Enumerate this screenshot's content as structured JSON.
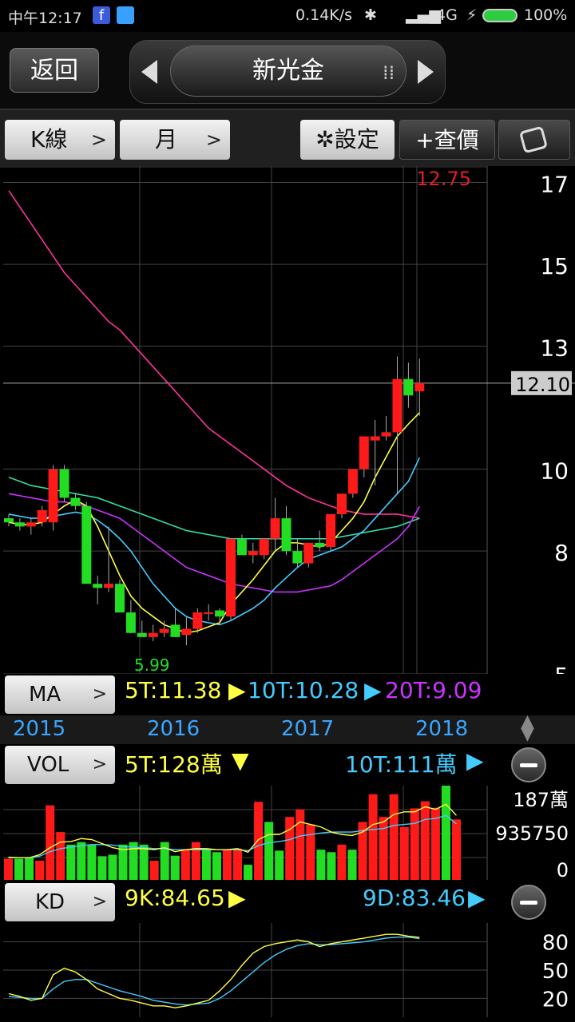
{
  "status_bar": {
    "time": "中午12:17",
    "speed": "0.14K/s",
    "network": "4G",
    "battery": "100%"
  },
  "header": {
    "back_label": "返回",
    "stock_name": "新光金"
  },
  "toolbar": {
    "chart_type": "K線",
    "period": "月",
    "settings_label": "✲設定",
    "lookup_label": "+查價"
  },
  "colors": {
    "up": "#ff1a1a",
    "down": "#22dd22",
    "ma5": "#ffff44",
    "ma10": "#44ccff",
    "ma20": "#cc33ff",
    "ma_long1": "#ff3399",
    "ma_long2": "#33ddaa"
  },
  "chart_data": {
    "type": "candlestick",
    "period": "monthly",
    "x_labels": [
      "2015",
      "2016",
      "2017",
      "2018"
    ],
    "price_axis": {
      "ticks": [
        5,
        8,
        10,
        13,
        15,
        17
      ],
      "range": [
        5,
        17
      ]
    },
    "last_price": "12.10",
    "max_label": "12.75",
    "min_label": "5.99",
    "candles": [
      [
        8.8,
        8.9,
        8.6,
        8.7
      ],
      [
        8.7,
        8.8,
        8.5,
        8.6
      ],
      [
        8.6,
        8.8,
        8.4,
        8.7
      ],
      [
        8.7,
        9.1,
        8.6,
        9.0
      ],
      [
        8.7,
        10.1,
        8.5,
        10.0
      ],
      [
        10.0,
        10.1,
        9.2,
        9.3
      ],
      [
        9.3,
        9.4,
        9.0,
        9.1
      ],
      [
        9.1,
        9.2,
        7.2,
        7.2
      ],
      [
        7.2,
        7.4,
        6.7,
        7.1
      ],
      [
        7.1,
        8.6,
        7.0,
        7.2
      ],
      [
        7.2,
        7.3,
        6.5,
        6.5
      ],
      [
        6.5,
        6.8,
        5.99,
        6.0
      ],
      [
        6.0,
        6.3,
        5.95,
        5.9
      ],
      [
        5.9,
        6.2,
        5.8,
        6.0
      ],
      [
        6.0,
        6.3,
        5.9,
        6.1
      ],
      [
        6.2,
        6.6,
        5.9,
        5.9
      ],
      [
        5.95,
        6.4,
        5.7,
        6.1
      ],
      [
        6.1,
        6.6,
        6.0,
        6.5
      ],
      [
        6.5,
        6.7,
        6.3,
        6.5
      ],
      [
        6.55,
        6.6,
        6.2,
        6.4
      ],
      [
        6.4,
        8.3,
        6.3,
        8.3
      ],
      [
        8.3,
        8.4,
        7.9,
        7.9
      ],
      [
        7.9,
        8.2,
        7.7,
        8.0
      ],
      [
        7.9,
        8.3,
        7.8,
        8.3
      ],
      [
        8.3,
        9.3,
        8.0,
        8.8
      ],
      [
        8.8,
        9.1,
        7.9,
        8.0
      ],
      [
        8.0,
        8.3,
        7.6,
        7.7
      ],
      [
        7.7,
        8.2,
        7.6,
        8.2
      ],
      [
        8.2,
        8.5,
        8.0,
        8.1
      ],
      [
        8.1,
        8.9,
        8.0,
        8.9
      ],
      [
        8.9,
        9.4,
        8.8,
        9.4
      ],
      [
        9.4,
        10.0,
        9.3,
        10.0
      ],
      [
        10.0,
        10.8,
        9.8,
        10.8
      ],
      [
        10.7,
        11.2,
        9.6,
        10.8
      ],
      [
        10.8,
        11.3,
        10.7,
        10.9
      ],
      [
        10.9,
        12.75,
        9.4,
        12.2
      ],
      [
        12.2,
        12.6,
        11.5,
        11.8
      ],
      [
        11.9,
        12.7,
        11.3,
        12.1
      ]
    ],
    "ma": {
      "labels": [
        "5T:11.38",
        "10T:10.28",
        "20T:9.09"
      ],
      "ma5": [
        8.7,
        8.65,
        8.65,
        8.7,
        8.9,
        9.1,
        9.25,
        9.1,
        8.6,
        8.0,
        7.4,
        6.9,
        6.6,
        6.4,
        6.2,
        6.1,
        6.0,
        6.05,
        6.15,
        6.25,
        6.7,
        7.0,
        7.3,
        7.65,
        8.0,
        8.2,
        8.2,
        8.15,
        8.1,
        8.2,
        8.5,
        8.8,
        9.2,
        9.8,
        10.3,
        10.8,
        11.1,
        11.38
      ],
      "ma10": [
        8.9,
        8.85,
        8.8,
        8.8,
        8.85,
        8.9,
        8.95,
        8.9,
        8.75,
        8.55,
        8.3,
        8.0,
        7.6,
        7.2,
        6.9,
        6.6,
        6.4,
        6.3,
        6.25,
        6.2,
        6.3,
        6.45,
        6.6,
        6.8,
        7.1,
        7.35,
        7.6,
        7.8,
        7.9,
        8.0,
        8.1,
        8.3,
        8.5,
        8.8,
        9.1,
        9.4,
        9.7,
        10.28
      ],
      "ma20": [
        9.4,
        9.35,
        9.3,
        9.25,
        9.2,
        9.2,
        9.15,
        9.1,
        9.0,
        8.9,
        8.8,
        8.6,
        8.4,
        8.2,
        8.0,
        7.8,
        7.6,
        7.5,
        7.4,
        7.3,
        7.2,
        7.15,
        7.1,
        7.05,
        7.0,
        7.0,
        7.0,
        7.05,
        7.1,
        7.15,
        7.3,
        7.5,
        7.7,
        7.9,
        8.1,
        8.3,
        8.6,
        9.09
      ],
      "ma_long1": [
        16.8,
        16.4,
        16.0,
        15.6,
        15.2,
        14.8,
        14.5,
        14.2,
        13.9,
        13.6,
        13.4,
        13.1,
        12.8,
        12.5,
        12.2,
        11.9,
        11.6,
        11.3,
        11.0,
        10.8,
        10.6,
        10.4,
        10.2,
        10.0,
        9.8,
        9.6,
        9.45,
        9.3,
        9.2,
        9.1,
        9.0,
        8.95,
        8.9,
        8.9,
        8.9,
        8.9,
        8.85,
        8.8
      ],
      "ma_long2": [
        9.8,
        9.7,
        9.6,
        9.55,
        9.5,
        9.45,
        9.4,
        9.35,
        9.3,
        9.2,
        9.1,
        9.0,
        8.9,
        8.8,
        8.7,
        8.6,
        8.5,
        8.45,
        8.4,
        8.35,
        8.3,
        8.3,
        8.3,
        8.3,
        8.3,
        8.3,
        8.3,
        8.3,
        8.3,
        8.3,
        8.35,
        8.4,
        8.45,
        8.5,
        8.55,
        8.6,
        8.7,
        8.8
      ]
    },
    "volume": {
      "labels": [
        "5T:128萬",
        "10T:111萬"
      ],
      "axis_labels": [
        "187萬",
        "935750",
        "0"
      ],
      "max": 1870000,
      "values": [
        420000,
        420000,
        450000,
        380000,
        1480000,
        950000,
        700000,
        750000,
        700000,
        470000,
        500000,
        700000,
        750000,
        700000,
        380000,
        750000,
        480000,
        600000,
        750000,
        600000,
        550000,
        600000,
        620000,
        300000,
        1550000,
        1150000,
        580000,
        1250000,
        1400000,
        1100000,
        600000,
        550000,
        700000,
        600000,
        1150000,
        1700000,
        1250000,
        1700000,
        1050000,
        1420000,
        1560000,
        1430000,
        1880000,
        1200000
      ],
      "up": [
        true,
        false,
        false,
        true,
        true,
        true,
        false,
        false,
        false,
        false,
        false,
        false,
        false,
        false,
        true,
        false,
        false,
        true,
        true,
        false,
        false,
        true,
        true,
        false,
        true,
        false,
        false,
        true,
        true,
        true,
        false,
        false,
        true,
        false,
        true,
        true,
        true,
        true,
        true,
        true,
        true,
        true,
        false,
        true
      ],
      "ma5": [
        450000,
        440000,
        440000,
        500000,
        640000,
        750000,
        760000,
        820000,
        800000,
        720000,
        640000,
        600000,
        620000,
        620000,
        600000,
        640000,
        560000,
        600000,
        620000,
        620000,
        600000,
        600000,
        620000,
        550000,
        800000,
        900000,
        900000,
        1000000,
        1150000,
        1100000,
        1050000,
        950000,
        900000,
        880000,
        950000,
        1100000,
        1150000,
        1300000,
        1350000,
        1350000,
        1450000,
        1400000,
        1500000,
        1280000
      ],
      "ma10": [
        440000,
        440000,
        440000,
        470000,
        560000,
        620000,
        650000,
        680000,
        700000,
        700000,
        690000,
        660000,
        650000,
        640000,
        620000,
        620000,
        600000,
        600000,
        600000,
        600000,
        600000,
        600000,
        600000,
        580000,
        680000,
        740000,
        760000,
        800000,
        870000,
        900000,
        930000,
        950000,
        950000,
        950000,
        980000,
        1000000,
        1020000,
        1080000,
        1100000,
        1120000,
        1200000,
        1220000,
        1280000,
        1110000
      ]
    },
    "kd": {
      "labels": [
        "9K:84.65",
        "9D:83.46"
      ],
      "axis_labels": [
        "80",
        "50",
        "20"
      ],
      "k": [
        25,
        22,
        18,
        20,
        45,
        52,
        48,
        40,
        30,
        25,
        20,
        18,
        15,
        12,
        12,
        10,
        12,
        15,
        18,
        28,
        40,
        55,
        68,
        75,
        78,
        80,
        82,
        80,
        75,
        78,
        80,
        82,
        84,
        86,
        88,
        88,
        86,
        84.65
      ],
      "d": [
        22,
        21,
        20,
        20,
        30,
        38,
        40,
        40,
        36,
        32,
        28,
        25,
        22,
        18,
        16,
        14,
        13,
        14,
        15,
        20,
        28,
        38,
        48,
        58,
        66,
        72,
        76,
        78,
        77,
        77,
        78,
        79,
        80,
        82,
        84,
        85,
        85,
        83.46
      ]
    }
  }
}
